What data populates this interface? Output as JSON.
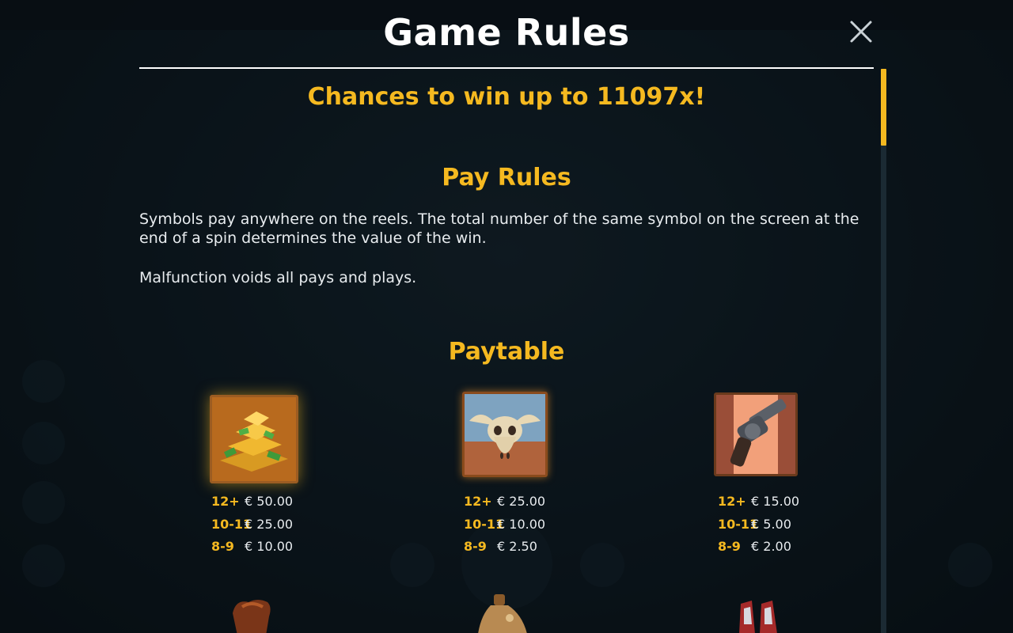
{
  "title": "Game Rules",
  "headline": "Chances to win up to 11097x!",
  "pay_rules": {
    "heading": "Pay Rules",
    "paragraph1": "Symbols pay anywhere on the reels. The total number of the same symbol on the screen at the end of a spin determines the value of the win.",
    "paragraph2": "Malfunction voids all pays and plays."
  },
  "paytable": {
    "heading": "Paytable",
    "symbols": [
      {
        "icon": "gold-bars-icon",
        "rows": [
          {
            "count": "12+",
            "value": "€ 50.00"
          },
          {
            "count": "10-11",
            "value": "€ 25.00"
          },
          {
            "count": "8-9",
            "value": "€ 10.00"
          }
        ]
      },
      {
        "icon": "bull-skull-icon",
        "rows": [
          {
            "count": "12+",
            "value": "€ 25.00"
          },
          {
            "count": "10-11",
            "value": "€ 10.00"
          },
          {
            "count": "8-9",
            "value": "€ 2.50"
          }
        ]
      },
      {
        "icon": "revolver-icon",
        "rows": [
          {
            "count": "12+",
            "value": "€ 15.00"
          },
          {
            "count": "10-11",
            "value": "€ 5.00"
          },
          {
            "count": "8-9",
            "value": "€ 2.00"
          }
        ]
      }
    ]
  },
  "colors": {
    "accent": "#f5b920",
    "text": "#e8ecef",
    "background": "#0b141a"
  }
}
